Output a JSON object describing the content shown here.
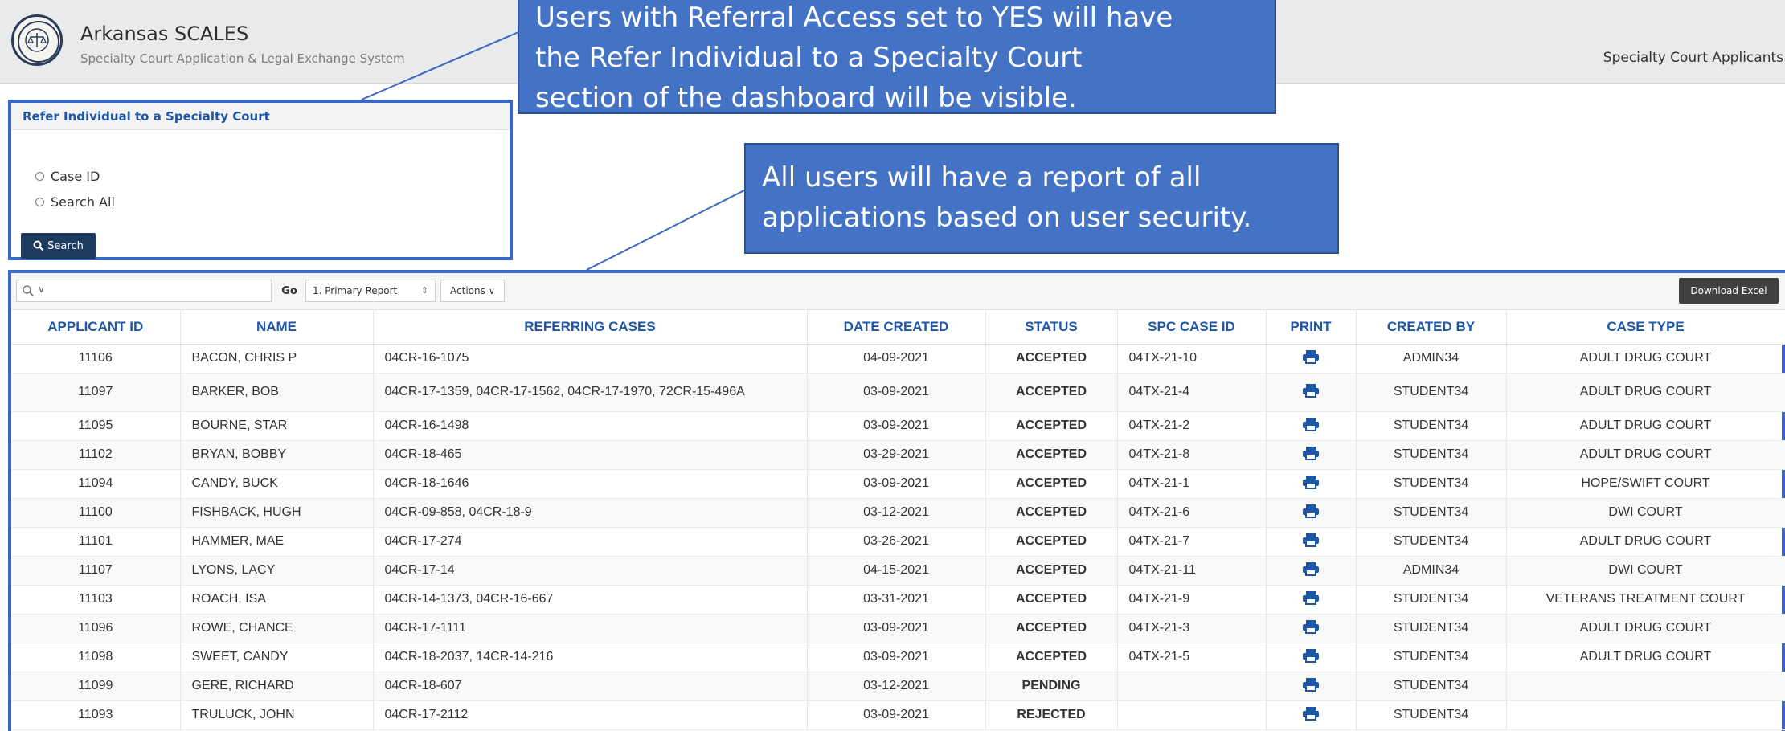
{
  "header": {
    "app_title": "Arkansas SCALES",
    "app_subtitle": "Specialty Court Application & Legal Exchange System",
    "nav_link": "Specialty Court Applicants"
  },
  "refer_panel": {
    "title": "Refer Individual to a Specialty Court",
    "options": [
      "Case ID",
      "Search All"
    ],
    "search_button": "Search"
  },
  "report": {
    "search_placeholder": "",
    "go_label": "Go",
    "report_selected": "1. Primary Report",
    "actions_label": "Actions",
    "download_label": "Download Excel",
    "columns": [
      "APPLICANT ID",
      "NAME",
      "REFERRING CASES",
      "DATE CREATED",
      "STATUS",
      "SPC CASE ID",
      "PRINT",
      "CREATED BY",
      "CASE TYPE"
    ],
    "rows": [
      {
        "id": "11106",
        "name": "BACON, CHRIS P",
        "cases": "04CR-16-1075",
        "date": "04-09-2021",
        "status": "ACCEPTED",
        "spc": "04TX-21-10",
        "created_by": "ADMIN34",
        "case_type": "ADULT DRUG COURT"
      },
      {
        "id": "11097",
        "name": "BARKER, BOB",
        "cases": "04CR-17-1359, 04CR-17-1562, 04CR-17-1970, 72CR-15-496A",
        "date": "03-09-2021",
        "status": "ACCEPTED",
        "spc": "04TX-21-4",
        "created_by": "STUDENT34",
        "case_type": "ADULT DRUG COURT"
      },
      {
        "id": "11095",
        "name": "BOURNE, STAR",
        "cases": "04CR-16-1498",
        "date": "03-09-2021",
        "status": "ACCEPTED",
        "spc": "04TX-21-2",
        "created_by": "STUDENT34",
        "case_type": "ADULT DRUG COURT"
      },
      {
        "id": "11102",
        "name": "BRYAN, BOBBY",
        "cases": "04CR-18-465",
        "date": "03-29-2021",
        "status": "ACCEPTED",
        "spc": "04TX-21-8",
        "created_by": "STUDENT34",
        "case_type": "ADULT DRUG COURT"
      },
      {
        "id": "11094",
        "name": "CANDY, BUCK",
        "cases": "04CR-18-1646",
        "date": "03-09-2021",
        "status": "ACCEPTED",
        "spc": "04TX-21-1",
        "created_by": "STUDENT34",
        "case_type": "HOPE/SWIFT COURT"
      },
      {
        "id": "11100",
        "name": "FISHBACK, HUGH",
        "cases": "04CR-09-858, 04CR-18-9",
        "date": "03-12-2021",
        "status": "ACCEPTED",
        "spc": "04TX-21-6",
        "created_by": "STUDENT34",
        "case_type": "DWI COURT"
      },
      {
        "id": "11101",
        "name": "HAMMER, MAE",
        "cases": "04CR-17-274",
        "date": "03-26-2021",
        "status": "ACCEPTED",
        "spc": "04TX-21-7",
        "created_by": "STUDENT34",
        "case_type": "ADULT DRUG COURT"
      },
      {
        "id": "11107",
        "name": "LYONS, LACY",
        "cases": "04CR-17-14",
        "date": "04-15-2021",
        "status": "ACCEPTED",
        "spc": "04TX-21-11",
        "created_by": "ADMIN34",
        "case_type": "DWI COURT"
      },
      {
        "id": "11103",
        "name": "ROACH, ISA",
        "cases": "04CR-14-1373, 04CR-16-667",
        "date": "03-31-2021",
        "status": "ACCEPTED",
        "spc": "04TX-21-9",
        "created_by": "STUDENT34",
        "case_type": "VETERANS TREATMENT COURT"
      },
      {
        "id": "11096",
        "name": "ROWE, CHANCE",
        "cases": "04CR-17-1111",
        "date": "03-09-2021",
        "status": "ACCEPTED",
        "spc": "04TX-21-3",
        "created_by": "STUDENT34",
        "case_type": "ADULT DRUG COURT"
      },
      {
        "id": "11098",
        "name": "SWEET, CANDY",
        "cases": "04CR-18-2037, 14CR-14-216",
        "date": "03-09-2021",
        "status": "ACCEPTED",
        "spc": "04TX-21-5",
        "created_by": "STUDENT34",
        "case_type": "ADULT DRUG COURT"
      },
      {
        "id": "11099",
        "name": "GERE, RICHARD",
        "cases": "04CR-18-607",
        "date": "03-12-2021",
        "status": "PENDING",
        "spc": "",
        "created_by": "STUDENT34",
        "case_type": ""
      },
      {
        "id": "11093",
        "name": "TRULUCK, JOHN",
        "cases": "04CR-17-2112",
        "date": "03-09-2021",
        "status": "REJECTED",
        "spc": "",
        "created_by": "STUDENT34",
        "case_type": ""
      }
    ]
  },
  "callouts": {
    "top": [
      "Users with Referral Access set to YES will have",
      "the Refer Individual to a Specialty Court",
      "section of the dashboard will be visible."
    ],
    "middle": [
      "All users will have a report of all",
      "applications based on user security."
    ]
  },
  "colors": {
    "accent": "#1f57a8",
    "callout": "#4472c4",
    "highlight_border": "#3a67c3",
    "accepted": "#1a9a27",
    "pending": "#e0a21a",
    "rejected": "#d02a1b"
  },
  "icons": {
    "logo": "state-seal-icon",
    "search": "magnifier-icon",
    "print": "printer-icon"
  }
}
